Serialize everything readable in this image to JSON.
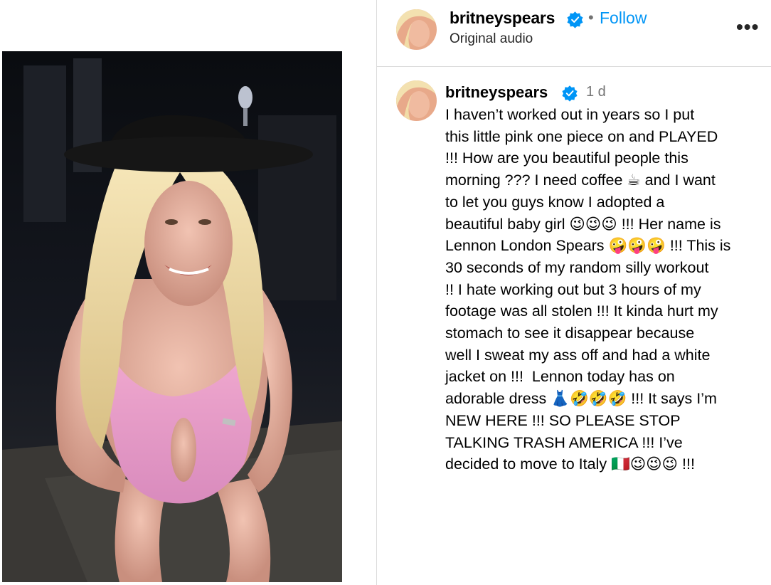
{
  "post": {
    "username": "britneyspears",
    "subtitle": "Original audio",
    "follow_label": "Follow",
    "separator": "•",
    "more_label": "•••",
    "time": "1 d",
    "caption": "I haven’t worked out in years so I put\nthis little pink one piece on and PLAYED\n!!! How are you beautiful people this\nmorning ??? I need coffee ☕ and I want\nto let you guys know I adopted a\nbeautiful baby girl 😉😉😉 !!! Her name is\nLennon London Spears 🤪🤪🤪 !!! This is\n30 seconds of my random silly workout\n!! I hate working out but 3 hours of my\nfootage was all stolen !!! It kinda hurt my\nstomach to see it disappear because\nwell I sweat my ass off and had a white\njacket on !!!  Lennon today has on\nadorable dress 👗🤣🤣🤣 !!! It says I’m\nNEW HERE !!! SO PLEASE STOP\nTALKING TRASH AMERICA !!! I’ve\ndecided to move to Italy 🇮🇹😉😉😉 !!!"
  },
  "colors": {
    "link": "#0095f6",
    "verified": "#0095f6",
    "muted": "#737373",
    "divider": "#dbdbdb"
  },
  "icons": {
    "verified": "verified-badge-icon",
    "more": "more-options-icon"
  }
}
